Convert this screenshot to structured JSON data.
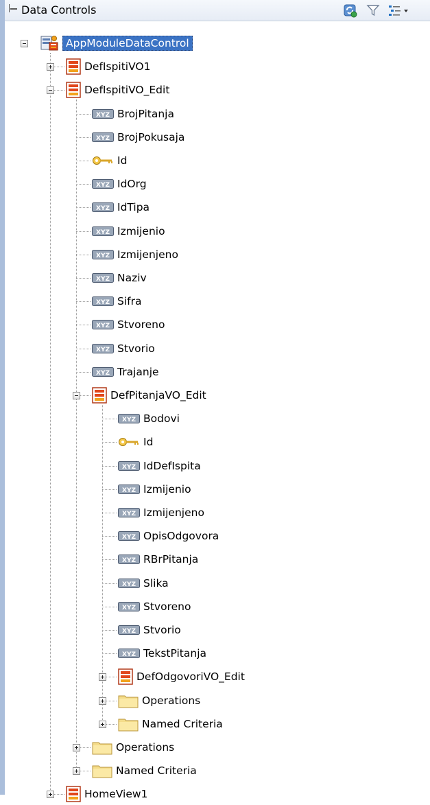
{
  "panel": {
    "title": "Data Controls",
    "toolbar_icons": [
      "refresh-icon",
      "filter-icon",
      "options-menu-icon"
    ]
  },
  "tree": [
    {
      "id": "n0",
      "label": "AppModuleDataControl",
      "icon": "app-module-icon",
      "level": 0,
      "toggle": "minus",
      "selected": true
    },
    {
      "id": "n1",
      "label": "DefIspitiVO1",
      "icon": "view-object-icon",
      "level": 1,
      "toggle": "plus"
    },
    {
      "id": "n2",
      "label": "DefIspitiVO_Edit",
      "icon": "view-object-icon",
      "level": 1,
      "toggle": "minus"
    },
    {
      "id": "n3",
      "label": "BrojPitanja",
      "icon": "attribute-icon",
      "level": 2
    },
    {
      "id": "n4",
      "label": "BrojPokusaja",
      "icon": "attribute-icon",
      "level": 2
    },
    {
      "id": "n5",
      "label": "Id",
      "icon": "key-icon",
      "level": 2
    },
    {
      "id": "n6",
      "label": "IdOrg",
      "icon": "attribute-icon",
      "level": 2
    },
    {
      "id": "n7",
      "label": "IdTipa",
      "icon": "attribute-icon",
      "level": 2
    },
    {
      "id": "n8",
      "label": "Izmijenio",
      "icon": "attribute-icon",
      "level": 2
    },
    {
      "id": "n9",
      "label": "Izmijenjeno",
      "icon": "attribute-icon",
      "level": 2
    },
    {
      "id": "n10",
      "label": "Naziv",
      "icon": "attribute-icon",
      "level": 2
    },
    {
      "id": "n11",
      "label": "Sifra",
      "icon": "attribute-icon",
      "level": 2
    },
    {
      "id": "n12",
      "label": "Stvoreno",
      "icon": "attribute-icon",
      "level": 2
    },
    {
      "id": "n13",
      "label": "Stvorio",
      "icon": "attribute-icon",
      "level": 2
    },
    {
      "id": "n14",
      "label": "Trajanje",
      "icon": "attribute-icon",
      "level": 2
    },
    {
      "id": "n15",
      "label": "DefPitanjaVO_Edit",
      "icon": "view-object-icon",
      "level": 2,
      "toggle": "minus"
    },
    {
      "id": "n16",
      "label": "Bodovi",
      "icon": "attribute-icon",
      "level": 3
    },
    {
      "id": "n17",
      "label": "Id",
      "icon": "key-icon",
      "level": 3
    },
    {
      "id": "n18",
      "label": "IdDefIspita",
      "icon": "attribute-icon",
      "level": 3
    },
    {
      "id": "n19",
      "label": "Izmijenio",
      "icon": "attribute-icon",
      "level": 3
    },
    {
      "id": "n20",
      "label": "Izmijenjeno",
      "icon": "attribute-icon",
      "level": 3
    },
    {
      "id": "n21",
      "label": "OpisOdgovora",
      "icon": "attribute-icon",
      "level": 3
    },
    {
      "id": "n22",
      "label": "RBrPitanja",
      "icon": "attribute-icon",
      "level": 3
    },
    {
      "id": "n23",
      "label": "Slika",
      "icon": "attribute-icon",
      "level": 3
    },
    {
      "id": "n24",
      "label": "Stvoreno",
      "icon": "attribute-icon",
      "level": 3
    },
    {
      "id": "n25",
      "label": "Stvorio",
      "icon": "attribute-icon",
      "level": 3
    },
    {
      "id": "n26",
      "label": "TekstPitanja",
      "icon": "attribute-icon",
      "level": 3
    },
    {
      "id": "n27",
      "label": "DefOdgovoriVO_Edit",
      "icon": "view-object-icon",
      "level": 3,
      "toggle": "plus"
    },
    {
      "id": "n28",
      "label": "Operations",
      "icon": "folder-icon",
      "level": 3,
      "toggle": "plus"
    },
    {
      "id": "n29",
      "label": "Named Criteria",
      "icon": "folder-icon",
      "level": 3,
      "toggle": "plus"
    },
    {
      "id": "n30",
      "label": "Operations",
      "icon": "folder-icon",
      "level": 2,
      "toggle": "plus"
    },
    {
      "id": "n31",
      "label": "Named Criteria",
      "icon": "folder-icon",
      "level": 2,
      "toggle": "plus"
    },
    {
      "id": "n32",
      "label": "HomeView1",
      "icon": "view-object-icon",
      "level": 1,
      "toggle": "plus"
    }
  ]
}
